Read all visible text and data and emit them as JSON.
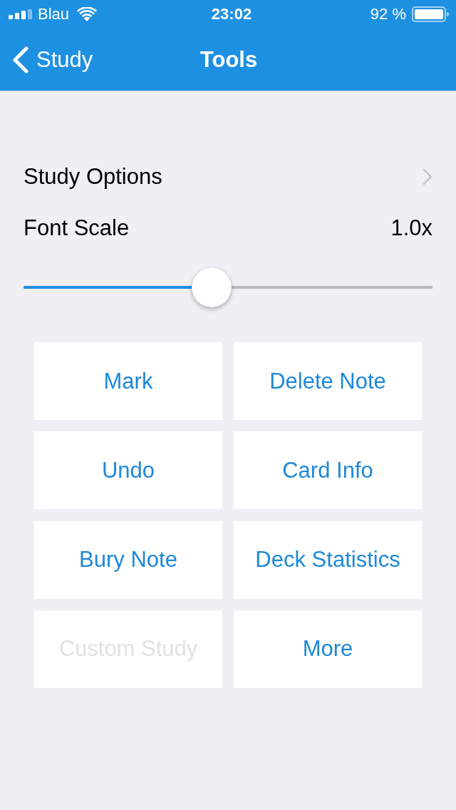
{
  "status_bar": {
    "carrier": "Blau",
    "time": "23:02",
    "battery": "92 %"
  },
  "nav_bar": {
    "back_label": "Study",
    "title": "Tools"
  },
  "settings": [
    {
      "kind": "link",
      "label": "Study Options"
    },
    {
      "kind": "slider",
      "label": "Font Scale",
      "value": "1.0x",
      "level": 0.46
    }
  ],
  "actions": [
    {
      "label": "Mark",
      "disabled": false
    },
    {
      "label": "Delete Note",
      "disabled": false
    },
    {
      "label": "Undo",
      "disabled": false
    },
    {
      "label": "Card Info",
      "disabled": false
    },
    {
      "label": "Bury Note",
      "disabled": false
    },
    {
      "label": "Deck Statistics",
      "disabled": false
    },
    {
      "label": "Custom Study",
      "disabled": true
    },
    {
      "label": "More",
      "disabled": false
    }
  ]
}
